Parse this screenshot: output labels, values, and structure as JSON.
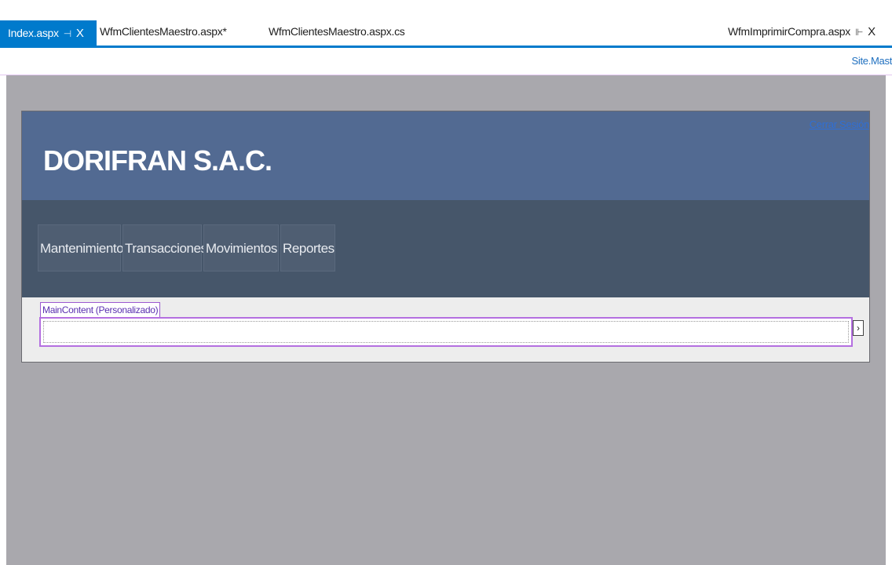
{
  "tabs": [
    {
      "label": "Index.aspx",
      "pin": "⊣",
      "close": "X",
      "active": true
    },
    {
      "label": "WfmClientesMaestro.aspx*"
    },
    {
      "label": "WfmClientesMaestro.aspx.cs"
    },
    {
      "label": "WfmImprimirCompra.aspx",
      "pin": "⊩",
      "close": "X"
    }
  ],
  "subbar": {
    "site_label": "Site.Mast"
  },
  "page": {
    "brand": "DORIFRAN S.A.C.",
    "logout": "Cerrar Sesión",
    "menu": [
      "Mantenimiento",
      "Transacciones",
      "Movimientos",
      "Reportes"
    ],
    "content_placeholder": {
      "tag": "MainContent (Personalizado)",
      "arrow": "›"
    }
  },
  "colors": {
    "accent": "#007acc",
    "header": "#526a92",
    "navband": "#46566a",
    "designer_bg": "#a9a8ad",
    "placeholder_border": "#b46fe0"
  }
}
